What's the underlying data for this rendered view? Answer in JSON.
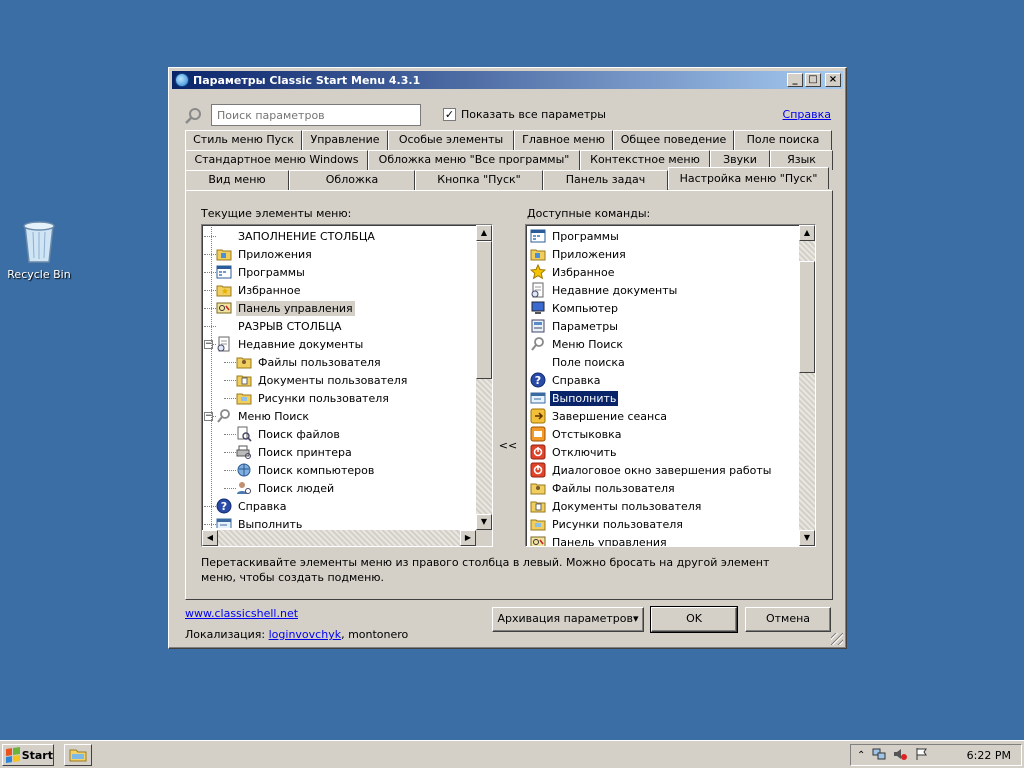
{
  "desktop": {
    "recycle_bin_label": "Recycle Bin"
  },
  "window": {
    "title": "Параметры Classic Start Menu 4.3.1",
    "controls": {
      "minimize": "_",
      "maximize": "□",
      "close": "×"
    }
  },
  "search": {
    "placeholder": "Поиск параметров",
    "show_all_label": "Показать все параметры",
    "show_all_checked": true,
    "help_link": "Справка"
  },
  "tabs": {
    "row1": [
      "Стиль меню Пуск",
      "Управление",
      "Особые элементы",
      "Главное меню",
      "Общее поведение",
      "Поле поиска"
    ],
    "row2": [
      "Стандартное меню Windows",
      "Обложка меню \"Все программы\"",
      "Контекстное меню",
      "Звуки",
      "Язык"
    ],
    "row3": [
      "Вид меню",
      "Обложка",
      "Кнопка \"Пуск\"",
      "Панель задач",
      "Настройка меню \"Пуск\""
    ],
    "active": "Настройка меню \"Пуск\""
  },
  "left_column": {
    "label": "Текущие элементы меню:",
    "items": [
      {
        "text": "ЗАПОЛНЕНИЕ СТОЛБЦА",
        "icon": "none-icon",
        "level": 0
      },
      {
        "text": "Приложения",
        "icon": "folder-apps-icon",
        "level": 0
      },
      {
        "text": "Программы",
        "icon": "programs-icon",
        "level": 0
      },
      {
        "text": "Избранное",
        "icon": "favorites-folder-icon",
        "level": 0
      },
      {
        "text": "Панель управления",
        "icon": "control-panel-icon",
        "level": 0,
        "selected": true
      },
      {
        "text": "РАЗРЫВ СТОЛБЦА",
        "icon": "none-icon",
        "level": 0
      },
      {
        "text": "Недавние документы",
        "icon": "recent-docs-icon",
        "level": 0,
        "expander": "−"
      },
      {
        "text": "Файлы пользователя",
        "icon": "user-files-icon",
        "level": 1
      },
      {
        "text": "Документы пользователя",
        "icon": "user-docs-icon",
        "level": 1
      },
      {
        "text": "Рисунки пользователя",
        "icon": "user-pictures-icon",
        "level": 1
      },
      {
        "text": "Меню Поиск",
        "icon": "search-menu-icon",
        "level": 0,
        "expander": "−"
      },
      {
        "text": "Поиск файлов",
        "icon": "find-files-icon",
        "level": 1
      },
      {
        "text": "Поиск принтера",
        "icon": "find-printer-icon",
        "level": 1
      },
      {
        "text": "Поиск компьютеров",
        "icon": "find-computers-icon",
        "level": 1
      },
      {
        "text": "Поиск людей",
        "icon": "find-people-icon",
        "level": 1
      },
      {
        "text": "Справка",
        "icon": "help-icon",
        "level": 0
      },
      {
        "text": "Выполнить",
        "icon": "run-icon",
        "level": 0
      }
    ]
  },
  "move_button": "<<",
  "right_column": {
    "label": "Доступные команды:",
    "items": [
      {
        "text": "Программы",
        "icon": "programs-icon"
      },
      {
        "text": "Приложения",
        "icon": "folder-apps-icon"
      },
      {
        "text": "Избранное",
        "icon": "favorites-star-icon"
      },
      {
        "text": "Недавние документы",
        "icon": "recent-docs-icon"
      },
      {
        "text": "Компьютер",
        "icon": "computer-icon"
      },
      {
        "text": "Параметры",
        "icon": "settings-icon"
      },
      {
        "text": "Меню Поиск",
        "icon": "search-menu-icon"
      },
      {
        "text": "Поле поиска",
        "icon": "none-icon"
      },
      {
        "text": "Справка",
        "icon": "help-icon"
      },
      {
        "text": "Выполнить",
        "icon": "run-icon",
        "selected": true
      },
      {
        "text": "Завершение сеанса",
        "icon": "logoff-icon"
      },
      {
        "text": "Отстыковка",
        "icon": "undock-icon"
      },
      {
        "text": "Отключить",
        "icon": "disconnect-icon"
      },
      {
        "text": "Диалоговое окно завершения работы",
        "icon": "shutdown-dialog-icon"
      },
      {
        "text": "Файлы пользователя",
        "icon": "user-files-icon"
      },
      {
        "text": "Документы пользователя",
        "icon": "user-docs-icon"
      },
      {
        "text": "Рисунки пользователя",
        "icon": "user-pictures-icon"
      },
      {
        "text": "Панель управления",
        "icon": "control-panel-icon"
      }
    ]
  },
  "hint": "Перетаскивайте элементы меню из правого столбца в левый. Можно бросать на другой элемент меню, чтобы создать подменю.",
  "footer": {
    "website": "www.classicshell.net",
    "locale_prefix": "Локализация: ",
    "locale_author_link": "loginvovchyk",
    "locale_rest": ", montonero",
    "backup_button": "Архивация параметров▾",
    "ok_button": "OK",
    "cancel_button": "Отмена"
  },
  "taskbar": {
    "start_label": "Start",
    "clock": "6:22 PM"
  }
}
